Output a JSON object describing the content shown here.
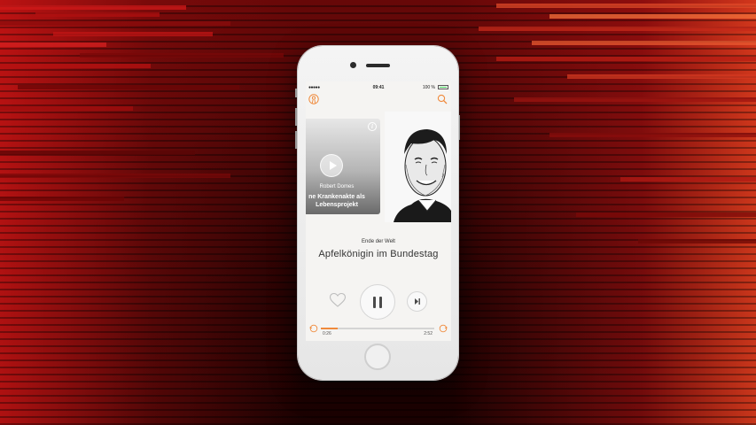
{
  "status_bar": {
    "signal": "●●●●● ",
    "time": "09:41",
    "battery": "100 %"
  },
  "colors": {
    "accent": "#f08a3c",
    "background": "#7a0a0a"
  },
  "header": {
    "left_icon": "podcaster-icon",
    "right_icon": "search-icon"
  },
  "episode_card": {
    "author": "Robert Domes",
    "title": "ne Krankenakte als Lebensprojekt",
    "info_icon": "info-icon",
    "play_icon": "play-icon"
  },
  "now_playing": {
    "show": "Ende der Welt",
    "title": "Apfelkönigin im Bundestag"
  },
  "controls": {
    "favorite": "heart-icon",
    "pause": "pause-icon",
    "next": "skip-next-icon"
  },
  "progress": {
    "elapsed": "0:26",
    "total": "2:52",
    "fraction": 0.15
  }
}
